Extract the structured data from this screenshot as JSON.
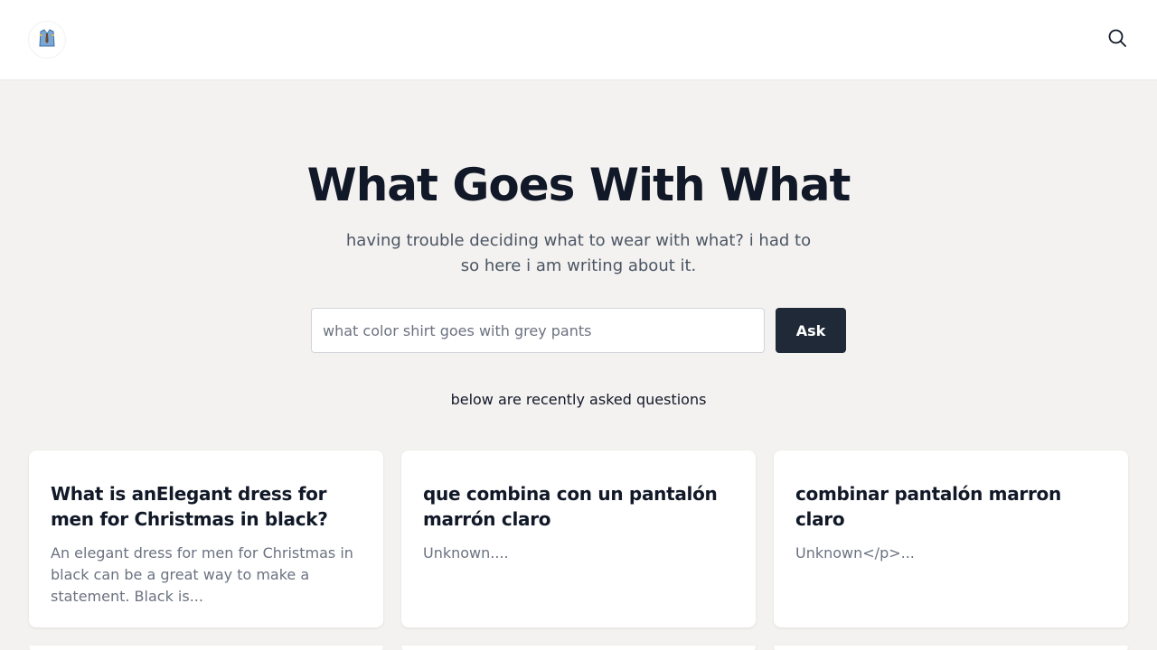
{
  "header": {
    "logo_icon": "shirt-tie-icon",
    "search_icon": "search-icon"
  },
  "hero": {
    "title": "What Goes With What",
    "subtitle": "having trouble deciding what to wear with what? i had to so here i am writing about it."
  },
  "ask": {
    "placeholder": "what color shirt goes with grey pants",
    "value": "",
    "button_label": "Ask"
  },
  "recent": {
    "label": "below are recently asked questions",
    "cards": [
      {
        "title": "What is anElegant dress for men for Christmas in black?",
        "excerpt": "An elegant dress for men for Christmas in black can be a great way to make a statement. Black is..."
      },
      {
        "title": "que combina con un pantalón marrón claro",
        "excerpt": "Unknown...."
      },
      {
        "title": "combinar pantalón marron claro",
        "excerpt": "Unknown</p>..."
      }
    ]
  },
  "colors": {
    "background": "#f3f2f0",
    "header": "#ffffff",
    "button": "#1f2937",
    "text": "#111827",
    "muted": "#6b7280"
  }
}
